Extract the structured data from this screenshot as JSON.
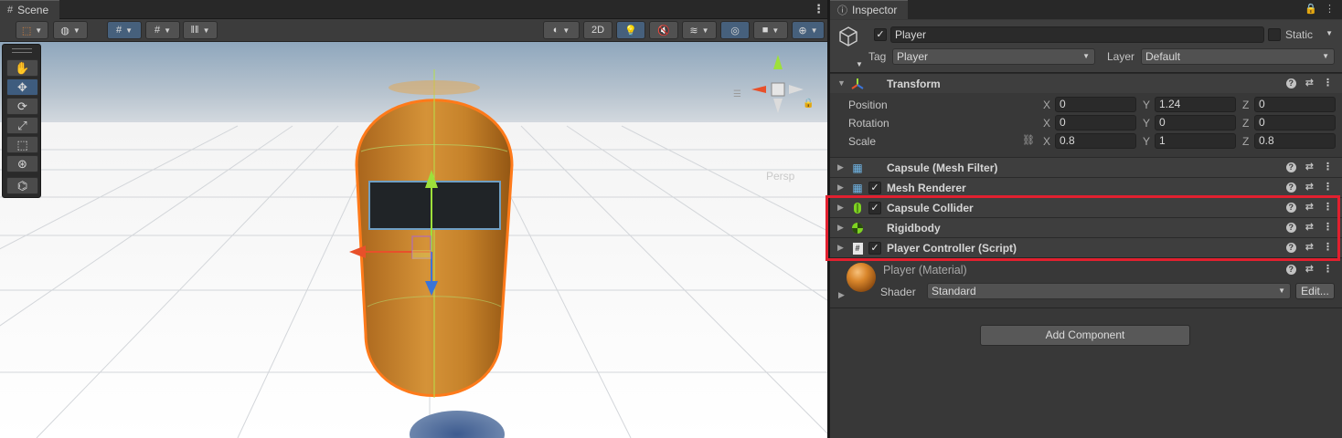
{
  "scene": {
    "tab_title": "Scene",
    "toolbar": {
      "toggle_2d": "2D"
    },
    "persp_label": "Persp"
  },
  "inspector": {
    "tab_title": "Inspector",
    "gameobject": {
      "name": "Player",
      "active": true,
      "static_label": "Static",
      "tag_label": "Tag",
      "tag_value": "Player",
      "layer_label": "Layer",
      "layer_value": "Default"
    },
    "transform": {
      "title": "Transform",
      "position_label": "Position",
      "rotation_label": "Rotation",
      "scale_label": "Scale",
      "position": {
        "x": "0",
        "y": "1.24",
        "z": "0"
      },
      "rotation": {
        "x": "0",
        "y": "0",
        "z": "0"
      },
      "scale": {
        "x": "0.8",
        "y": "1",
        "z": "0.8"
      },
      "axis_x": "X",
      "axis_y": "Y",
      "axis_z": "Z"
    },
    "components": [
      {
        "title": "Capsule (Mesh Filter)",
        "icon": "grid-icon",
        "has_checkbox": false
      },
      {
        "title": "Mesh Renderer",
        "icon": "grid-icon",
        "has_checkbox": true
      },
      {
        "title": "Capsule Collider",
        "icon": "capsule-collider-icon",
        "has_checkbox": true
      },
      {
        "title": "Rigidbody",
        "icon": "rigidbody-icon",
        "has_checkbox": false
      },
      {
        "title": "Player Controller (Script)",
        "icon": "script-icon",
        "has_checkbox": true
      }
    ],
    "material": {
      "name": "Player (Material)",
      "shader_label": "Shader",
      "shader_value": "Standard",
      "edit_label": "Edit..."
    },
    "add_component_label": "Add Component"
  },
  "colors": {
    "highlight": "#e2202f",
    "capsule_orange": "#c98328",
    "selection_outline": "#ff7a1a",
    "active_tool": "#3e5c7e"
  }
}
